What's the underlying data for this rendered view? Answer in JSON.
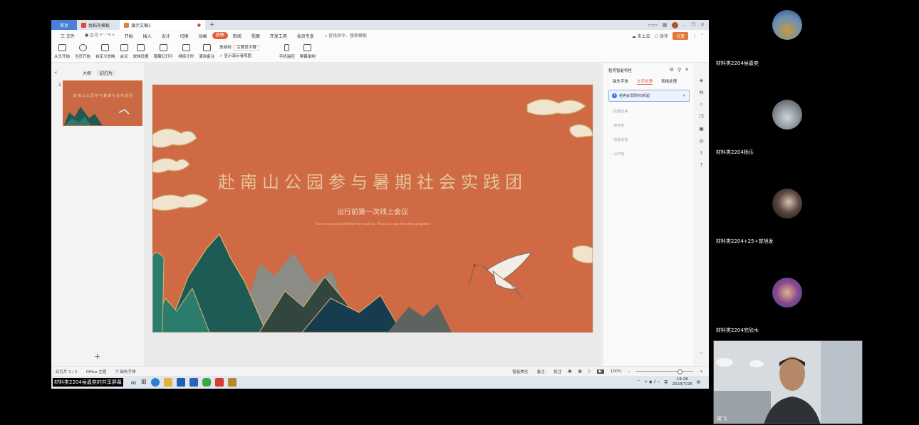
{
  "browser_tabs": [
    {
      "label": "首页"
    },
    {
      "label": "找稻壳模板"
    },
    {
      "label": "演示文稿1",
      "active": true
    }
  ],
  "menu": [
    "三 文件",
    "开始",
    "插入",
    "设计",
    "切换",
    "动画",
    "放映",
    "审阅",
    "视图",
    "开发工具",
    "会员专享"
  ],
  "menu_active": "放映",
  "menu_search": "查找命令、搜索模板",
  "menu_right": {
    "cloud": "未上云",
    "collab": "协作",
    "share": "分享"
  },
  "ribbon": {
    "buttons": [
      "从头开始",
      "当页开始",
      "自定义放映",
      "会议",
      "放映设置",
      "隐藏幻灯片",
      "排练计时",
      "演讲备注"
    ],
    "select_label": "放映到:",
    "select_value": "主要显示器",
    "checkbox_label": "显示演示者视图",
    "extra": [
      "手机遥控",
      "屏幕录制"
    ]
  },
  "left_panel": {
    "tabs": [
      "大纲",
      "幻灯片"
    ],
    "slide_number": "1"
  },
  "slide": {
    "title": "赴南山公园参与暑期社会实践团",
    "subtitle": "出行前第一次线上会议",
    "tiny_text": "There's no shortcut left from the small ice. There's a crown from the cold golden"
  },
  "right_panel": {
    "title": "稻壳智能特性 ·",
    "tabs": [
      "缺失字体",
      "文字处理",
      "表格处理"
    ],
    "notice": "稻壳会员限时5折起",
    "items": [
      "批量替换",
      "换字体",
      "批量去除",
      "分节框"
    ]
  },
  "status": {
    "slide_info": "幻灯片 1 / 1",
    "theme": "Office 主题",
    "font_missing": "缺失字体",
    "beautify": "智能美化 ·",
    "notes": "备注 ·",
    "comments": "批注",
    "zoom": "100%"
  },
  "taskbar": {
    "caption": "材料类2204侯嘉奕的共享屏幕",
    "time": "19:28",
    "date": "2023/7/26",
    "ime": "英"
  },
  "participants": [
    {
      "name": "材料类2204侯嘉奕"
    },
    {
      "name": "材料类2204杨乐"
    },
    {
      "name": "材料类2204+25+曾旭发"
    },
    {
      "name": "材料类2204完欣木"
    }
  ],
  "video": {
    "name": "梁飞"
  },
  "colors": {
    "accent": "#e0633f",
    "slide_bg": "#cf6a44",
    "title_gold": "#e2c79a"
  }
}
